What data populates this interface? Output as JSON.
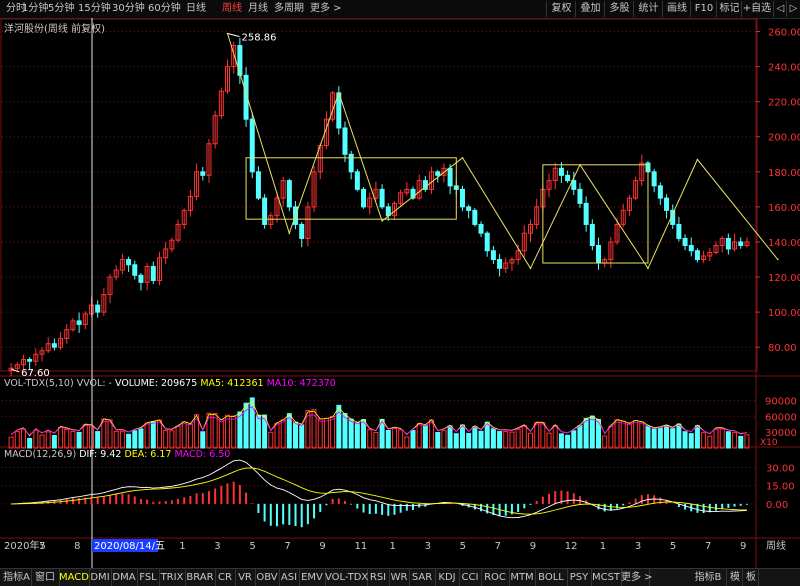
{
  "toolbar": {
    "periods": [
      "分时",
      "1分钟",
      "5分钟",
      "15分钟",
      "30分钟",
      "60分钟",
      "日线",
      "周线",
      "月线",
      "多周期",
      "更多 >"
    ],
    "active_period": "周线",
    "right_buttons": [
      "复权",
      "叠加",
      "多股",
      "统计",
      "画线",
      "F10",
      "标记",
      "+自选",
      "◁",
      "▷"
    ]
  },
  "stock_title": "洋河股份(周线 前复权)",
  "indicators": {
    "vol": {
      "name": "VOL-TDX(5,10)",
      "vvol": "VVOL: -",
      "volume": "VOLUME: 209675",
      "ma5": "MA5: 412361",
      "ma10": "MA10: 472370"
    },
    "macd": {
      "name": "MACD(12,26,9)",
      "dif": "DIF: 9.42",
      "dea": "DEA: 6.17",
      "macd": "MACD: 6.50"
    },
    "vol_unit": "X10"
  },
  "time_axis": {
    "labels": [
      "2020年5",
      "7",
      "8",
      "10",
      "12",
      "1",
      "3",
      "5",
      "7",
      "9",
      "11",
      "1",
      "3",
      "5",
      "7",
      "9",
      "12",
      "1",
      "3",
      "5",
      "7",
      "9"
    ],
    "cursor_label": "2020/08/14/五",
    "right_label": "周线"
  },
  "bottom_tabs": [
    "指标A",
    "窗口",
    "MACD",
    "DMI",
    "DMA",
    "FSL",
    "TRIX",
    "BRAR",
    "CR",
    "VR",
    "OBV",
    "ASI",
    "EMV",
    "VOL-TDX",
    "RSI",
    "WR",
    "SAR",
    "KDJ",
    "CCI",
    "ROC",
    "MTM",
    "BOLL",
    "PSY",
    "MCST",
    "更多 >"
  ],
  "bottom_right": [
    "指标B",
    "模",
    "板"
  ],
  "colors": {
    "up": "#ff3232",
    "down": "#54ffff",
    "ma5": "#ffffff",
    "ma10": "#ffff00",
    "ma20": "#ff00ff",
    "pattern": "#e8e060",
    "grid": "#7a1010"
  },
  "chart_data": [
    {
      "type": "candlestick",
      "title": "洋河股份(周线 前复权)",
      "y_ticks": [
        260,
        240,
        220,
        200,
        180,
        160,
        140,
        120,
        100,
        80
      ],
      "ylim": [
        67,
        262
      ],
      "annotations": [
        {
          "text": "258.86",
          "value": 258.86
        },
        {
          "text": "67.60",
          "value": 67.6
        }
      ],
      "close": [
        68,
        70,
        73,
        72,
        76,
        78,
        82,
        80,
        85,
        90,
        95,
        93,
        99,
        104,
        100,
        110,
        120,
        124,
        130,
        127,
        121,
        117,
        126,
        118,
        131,
        136,
        141,
        150,
        158,
        166,
        180,
        178,
        196,
        212,
        226,
        240,
        252,
        235,
        210,
        180,
        165,
        150,
        155,
        165,
        175,
        160,
        150,
        142,
        160,
        180,
        195,
        210,
        225,
        205,
        190,
        180,
        170,
        160,
        165,
        170,
        160,
        155,
        162,
        168,
        170,
        165,
        175,
        170,
        180,
        178,
        182,
        172,
        170,
        160,
        158,
        150,
        145,
        135,
        130,
        125,
        128,
        130,
        135,
        145,
        150,
        160,
        170,
        175,
        182,
        178,
        175,
        170,
        162,
        150,
        138,
        128,
        130,
        140,
        150,
        158,
        165,
        175,
        185,
        180,
        172,
        165,
        158,
        150,
        142,
        138,
        135,
        130,
        132,
        134,
        138,
        142,
        136,
        140,
        138,
        140
      ],
      "pattern_lines": [
        [
          [
            1,
            162
          ],
          [
            1,
            70
          ]
        ],
        [
          [
            35,
            258
          ],
          [
            35,
            70
          ]
        ]
      ],
      "boxes": [
        {
          "from": 38,
          "to": 72,
          "low": 153,
          "high": 188
        },
        {
          "from": 86,
          "to": 103,
          "low": 128,
          "high": 184
        }
      ],
      "zigzag": [
        [
          35,
          258.86
        ],
        [
          45,
          145
        ],
        [
          53,
          225
        ],
        [
          60,
          152
        ],
        [
          73,
          188
        ],
        [
          84,
          125
        ],
        [
          92,
          184
        ],
        [
          103,
          125
        ],
        [
          111,
          187
        ],
        [
          124,
          130
        ]
      ]
    },
    {
      "type": "bar",
      "title": "VOL-TDX(5,10)",
      "y_ticks": [
        90000,
        60000,
        30000
      ],
      "ylim": [
        0,
        110000
      ],
      "series": [
        {
          "name": "MA5"
        },
        {
          "name": "MA10"
        }
      ]
    },
    {
      "type": "bar",
      "title": "MACD(12,26,9)",
      "y_ticks": [
        30.0,
        15.0,
        0.0
      ],
      "ylim": [
        -28,
        36
      ],
      "series": [
        {
          "name": "DIF"
        },
        {
          "name": "DEA"
        },
        {
          "name": "MACD"
        }
      ]
    }
  ]
}
